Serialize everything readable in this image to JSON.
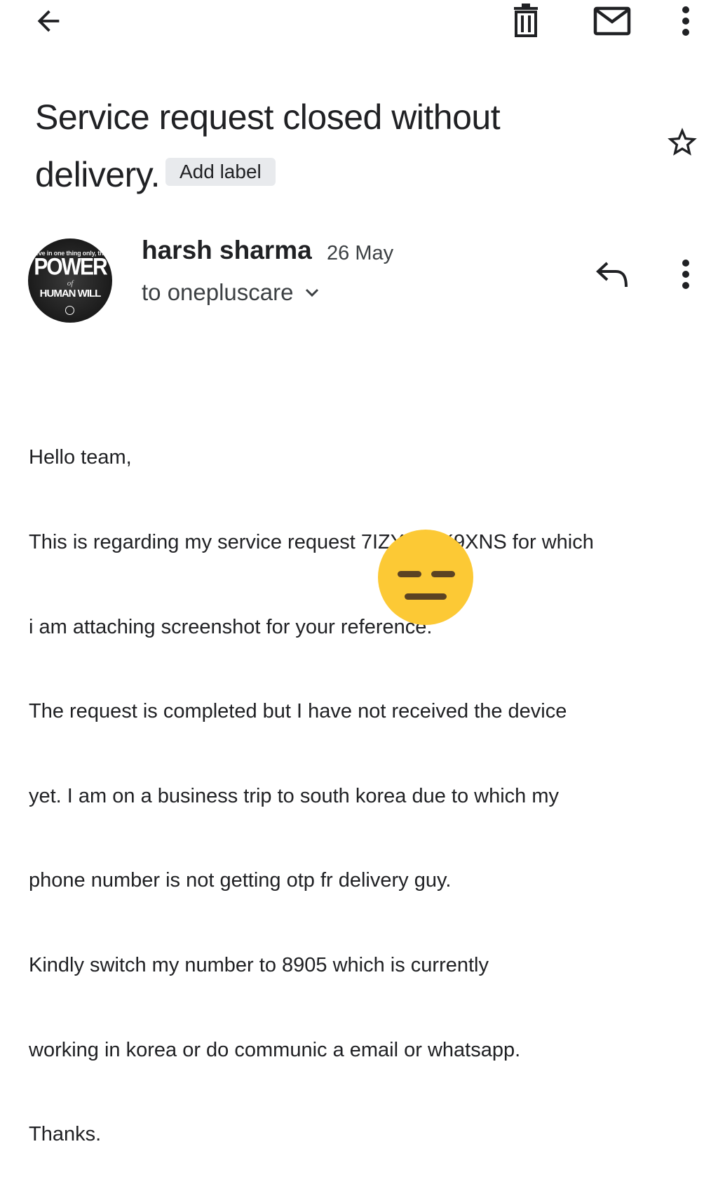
{
  "toolbar": {
    "back_icon": "arrow-back-icon",
    "delete_icon": "trash-icon",
    "mark_unread_icon": "mail-icon",
    "more_icon": "more-vertical-icon"
  },
  "email": {
    "subject_line1": "Service request closed without",
    "subject_line2": "delivery.",
    "label_chip": "Add label",
    "star_icon": "star-outline-icon",
    "sender": {
      "avatar_text_top": "ieve in one thing only, the",
      "avatar_text_power": "POWER",
      "avatar_text_of": "of",
      "avatar_text_will": "HUMAN WILL",
      "name": "harsh sharma",
      "date": "26 May",
      "recipient": "to onepluscare",
      "reply_icon": "reply-icon",
      "more_icon": "more-vertical-icon",
      "expand_icon": "chevron-down-icon"
    },
    "body_lines": [
      "Hello team,",
      "This is regarding my service request 7IZYFZ4K9XNS for which",
      "i am attaching screenshot for your reference.",
      "The request is completed but I have not received the device",
      "yet. I am on a business trip to south korea due to which my",
      "phone number is not getting otp fr        delivery guy.",
      "Kindly switch my number to 8905            which is currently",
      "working in korea or do communic            a email or whatsapp.",
      "Thanks."
    ],
    "overlay_icon": "expressionless-face-emoji",
    "overlay_color": "#fcc935"
  }
}
